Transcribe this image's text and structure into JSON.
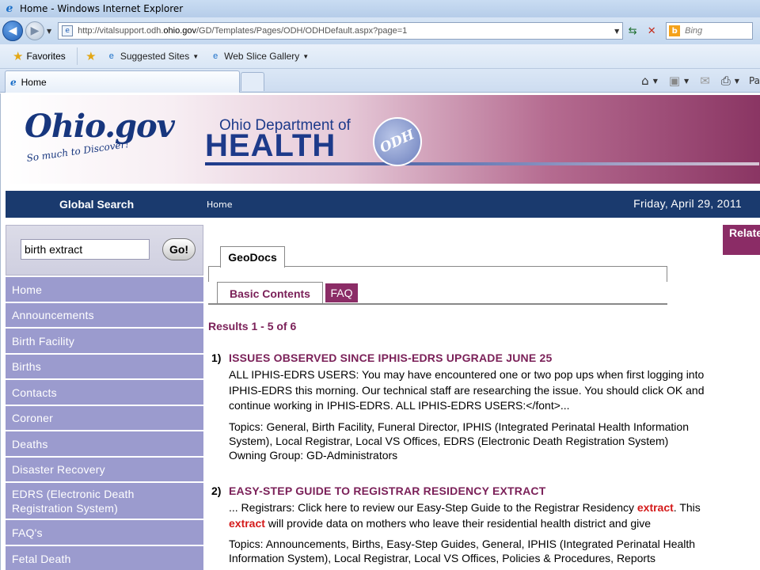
{
  "window": {
    "title": "Home - Windows Internet Explorer"
  },
  "address": {
    "url_prefix": "http://vitalsupport.odh.",
    "url_domain": "ohio.gov",
    "url_suffix": "/GD/Templates/Pages/ODH/ODHDefault.aspx?page=1"
  },
  "search": {
    "placeholder": "Bing"
  },
  "favorites_bar": {
    "favorites_label": "Favorites",
    "suggested_sites": "Suggested Sites",
    "web_slice_gallery": "Web Slice Gallery"
  },
  "tab": {
    "label": "Home"
  },
  "command_bar": {
    "page_label": "Pa"
  },
  "banner": {
    "ohio_logo_text": "Ohio.gov",
    "ohio_tagline": "So much to Discover!",
    "odh_subtitle": "Ohio Department of",
    "odh_title": "HEALTH",
    "odh_seal": "ODH"
  },
  "navbar": {
    "global_search": "Global Search",
    "home_link": "Home",
    "date": "Friday, April 29, 2011"
  },
  "sidebar": {
    "search_value": "birth extract",
    "go_label": "Go!",
    "menu": [
      {
        "label": "Home"
      },
      {
        "label": "Announcements"
      },
      {
        "label": "Birth Facility"
      },
      {
        "label": "Births"
      },
      {
        "label": "Contacts"
      },
      {
        "label": "Coroner"
      },
      {
        "label": "Deaths"
      },
      {
        "label": "Disaster Recovery"
      },
      {
        "label": "EDRS (Electronic Death Registration System)"
      },
      {
        "label": "FAQ's"
      },
      {
        "label": "Fetal Death"
      }
    ]
  },
  "main": {
    "geodocs_tab": "GeoDocs",
    "basic_contents_tab": "Basic Contents",
    "faq_tab": "FAQ",
    "results_count": "Results 1 - 5 of 6",
    "results": [
      {
        "num": "1)",
        "title": "ISSUES OBSERVED SINCE IPHIS-EDRS UPGRADE JUNE 25",
        "snippet": "ALL IPHIS-EDRS USERS: You may have encountered one or two pop ups when first logging into IPHIS-EDRS this morning. Our technical staff are researching the issue. You should click OK and continue working in IPHIS-EDRS. ALL IPHIS-EDRS USERS:</font>...",
        "topics": "Topics:  General, Birth Facility, Funeral Director, IPHIS (Integrated Perinatal Health Information System), Local Registrar, Local VS Offices, EDRS (Electronic Death Registration System)",
        "owning_group": "Owning Group: GD-Administrators"
      },
      {
        "num": "2)",
        "title": "EASY-STEP GUIDE TO REGISTRAR RESIDENCY EXTRACT",
        "snippet_a": "... Registrars: Click here to review our Easy-Step Guide to the Registrar Residency ",
        "snippet_hl1": "extract",
        "snippet_b": ". This ",
        "snippet_hl2": "extract",
        "snippet_c": " will provide data on mothers who leave their residential health district and give",
        "topics": "Topics:  Announcements, Births, Easy-Step Guides, General, IPHIS (Integrated Perinatal Health Information System), Local Registrar, Local VS Offices, Policies & Procedures, Reports"
      }
    ]
  },
  "related_links": {
    "label": "Related Links"
  },
  "colors": {
    "nav_blue": "#1a3a6e",
    "plum": "#7b2159",
    "menu_lavender": "#9b9bce",
    "highlight_red": "#d41a1a"
  }
}
